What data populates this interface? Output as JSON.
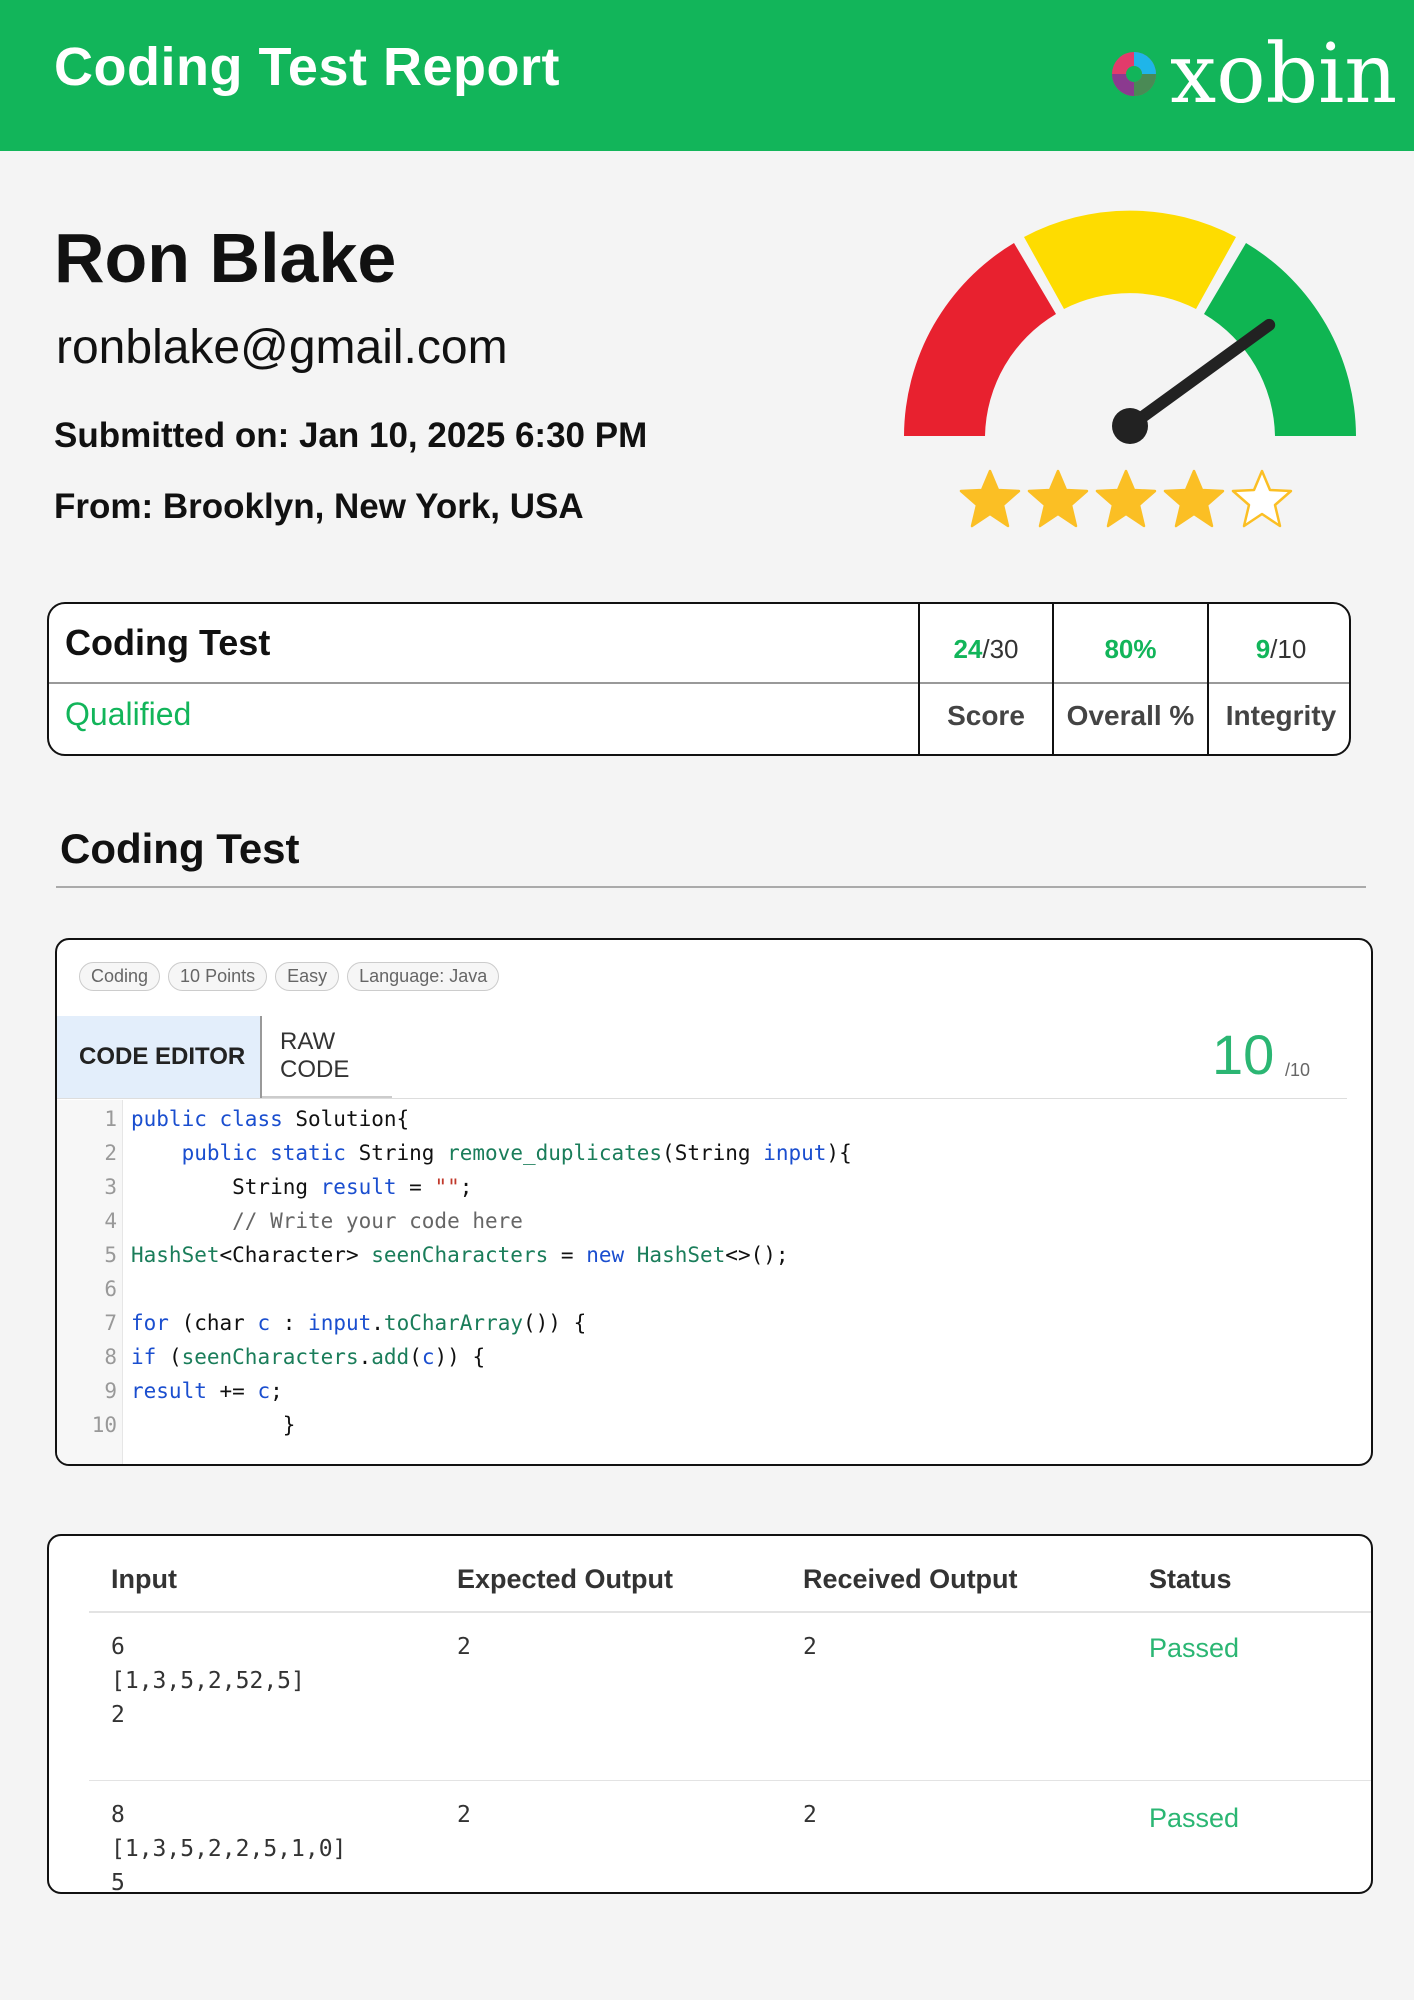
{
  "header": {
    "title": "Coding Test Report",
    "brand": "xobin"
  },
  "candidate": {
    "name": "Ron Blake",
    "email": "ronblake@gmail.com",
    "submitted": "Submitted on: Jan 10, 2025 6:30 PM",
    "location": "From: Brooklyn, New York, USA"
  },
  "rating": {
    "stars": 4,
    "max_stars": 5,
    "gauge_level": 0.8
  },
  "colors": {
    "brand_green": "#12b55a",
    "gauge_red": "#e8212f",
    "gauge_yellow": "#fedc00",
    "gauge_green": "#0fb552",
    "star": "#fbbf24"
  },
  "summary": {
    "test_name": "Coding Test",
    "status": "Qualified",
    "score": {
      "value": "24",
      "total": "/30",
      "label": "Score"
    },
    "overall": {
      "value": "80%",
      "label": "Overall %"
    },
    "integrity": {
      "value": "9",
      "total": "/10",
      "label": "Integrity"
    }
  },
  "section": {
    "title": "Coding Test"
  },
  "question": {
    "tags": [
      "Coding",
      "10 Points",
      "Easy",
      "Language: Java"
    ],
    "tabs": {
      "active": "CODE EDITOR",
      "other": "RAW CODE"
    },
    "score": "10",
    "score_total": "/10",
    "line_numbers": [
      "1",
      "2",
      "3",
      "4",
      "5",
      "6",
      "7",
      "8",
      "9",
      "10"
    ]
  },
  "results": {
    "headers": [
      "Input",
      "Expected Output",
      "Received Output",
      "Status"
    ],
    "rows": [
      {
        "input": "6\n[1,3,5,2,52,5]\n2",
        "expected": "2",
        "received": "2",
        "status": "Passed"
      },
      {
        "input": "8\n[1,3,5,2,2,5,1,0]\n5",
        "expected": "2",
        "received": "2",
        "status": "Passed"
      }
    ]
  }
}
